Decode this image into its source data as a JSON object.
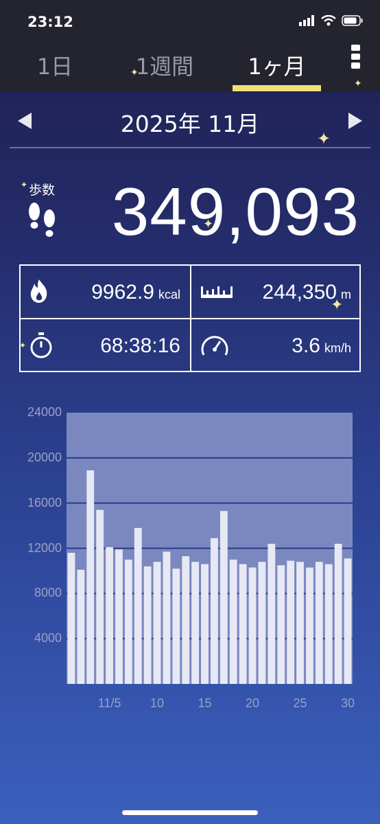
{
  "status": {
    "time": "23:12"
  },
  "tabs": [
    {
      "label": "1日",
      "active": false
    },
    {
      "label": "1週間",
      "active": false
    },
    {
      "label": "1ヶ月",
      "active": true
    }
  ],
  "month_nav": {
    "label": "2025年 11月"
  },
  "steps": {
    "label": "歩数",
    "value": "349,093"
  },
  "stats": {
    "calories": {
      "value": "9962.9",
      "unit": "kcal"
    },
    "distance": {
      "value": "244,350",
      "unit": "m"
    },
    "duration": {
      "value": "68:38:16"
    },
    "speed": {
      "value": "3.6",
      "unit": "km/h"
    }
  },
  "colors": {
    "accent": "#f0e07a",
    "bar": "#e6e8f4",
    "chart_bg": "#7b88bf",
    "grid": "#2a3a8e"
  },
  "chart_data": {
    "type": "bar",
    "x": [
      1,
      2,
      3,
      4,
      5,
      6,
      7,
      8,
      9,
      10,
      11,
      12,
      13,
      14,
      15,
      16,
      17,
      18,
      19,
      20,
      21,
      22,
      23,
      24,
      25,
      26,
      27,
      28,
      29,
      30
    ],
    "values": [
      11600,
      10100,
      18900,
      15400,
      12100,
      11900,
      11000,
      13800,
      10400,
      10800,
      11700,
      10200,
      11300,
      10800,
      10600,
      12900,
      15300,
      11000,
      10600,
      10300,
      10800,
      12400,
      10500,
      10900,
      10800,
      10300,
      10800,
      10600,
      12400,
      11100
    ],
    "ylim": [
      0,
      24000
    ],
    "yticks": [
      "24000",
      "20000",
      "16000",
      "12000",
      "8000",
      "4000"
    ],
    "xticks": [
      {
        "day": 5,
        "label": "11/5"
      },
      {
        "day": 10,
        "label": "10"
      },
      {
        "day": 15,
        "label": "15"
      },
      {
        "day": 20,
        "label": "20"
      },
      {
        "day": 25,
        "label": "25"
      },
      {
        "day": 30,
        "label": "30"
      }
    ]
  }
}
